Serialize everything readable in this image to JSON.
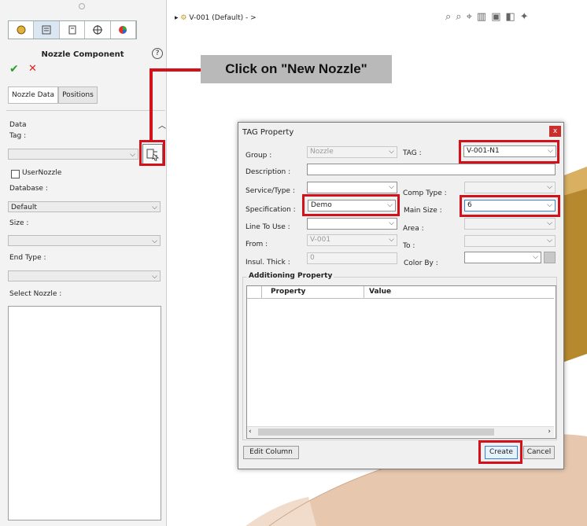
{
  "left_panel": {
    "title": "Nozzle Component",
    "help_icon": "?",
    "tabs": [
      "Nozzle Data",
      "Positions"
    ],
    "section_title": "Data",
    "tag_label": "Tag :",
    "tag_value": "",
    "user_nozzle_label": "UserNozzle",
    "database_label": "Database :",
    "database_value": "Default",
    "size_label": "Size :",
    "size_value": "",
    "end_type_label": "End Type :",
    "end_type_value": "",
    "select_nozzle_label": "Select Nozzle :",
    "icons": [
      "part-icon",
      "feature-tree-icon",
      "property-icon",
      "origin-icon",
      "appearance-icon",
      "new-nozzle-icon"
    ]
  },
  "viewport": {
    "breadcrumb": "V-001  (Default) - >",
    "callout": "Click on \"New Nozzle\""
  },
  "dialog": {
    "title": "TAG Property",
    "close": "x",
    "group_label": "Group :",
    "group_value": "Nozzle",
    "tag_label": "TAG :",
    "tag_value": "V-001-N1",
    "description_label": "Description :",
    "description_value": "",
    "service_label": "Service/Type :",
    "service_value": "",
    "comp_type_label": "Comp Type :",
    "comp_type_value": "",
    "spec_label": "Specification :",
    "spec_value": "Demo",
    "main_size_label": "Main Size :",
    "main_size_value": "6",
    "line_label": "Line To Use :",
    "line_value": "",
    "area_label": "Area :",
    "area_value": "",
    "from_label": "From :",
    "from_value": "V-001",
    "to_label": "To :",
    "to_value": "",
    "insul_label": "Insul. Thick :",
    "insul_value": "0",
    "color_label": "Color By :",
    "color_value": "",
    "section_label": "Additioning Property",
    "grid_columns": [
      "Property",
      "Value"
    ],
    "edit_column_button": "Edit Column",
    "create_button": "Create",
    "cancel_button": "Cancel"
  },
  "colors": {
    "highlight": "#d4111a",
    "callout_bg": "#b9b9b9",
    "model_tan": "#e7c8ae",
    "model_gold": "#b7892f"
  }
}
